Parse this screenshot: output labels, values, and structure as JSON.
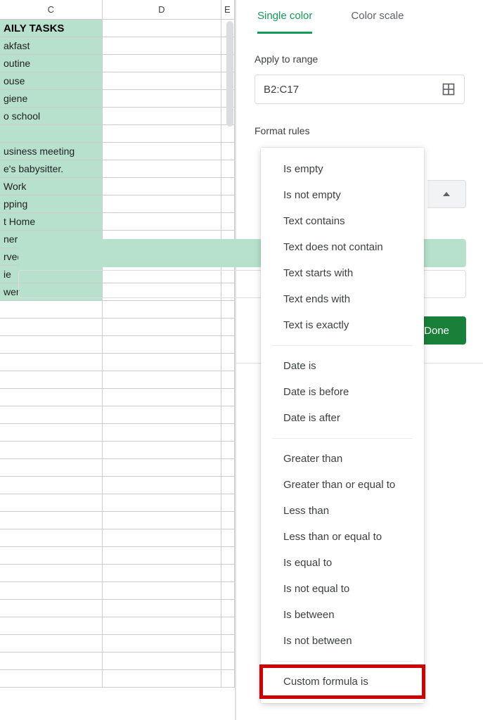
{
  "columns": {
    "c": "C",
    "d": "D",
    "e": "E"
  },
  "header_cell": "AILY TASKS",
  "task_rows": [
    "akfast",
    "outine",
    "ouse",
    "giene",
    "o school",
    "",
    "usiness meeting",
    "e's babysitter.",
    "Work",
    "pping",
    "t Home",
    "ner",
    "rved",
    "ie",
    "wer"
  ],
  "empty_row_count": 22,
  "sidebar": {
    "tabs": {
      "single_color": "Single color",
      "color_scale": "Color scale"
    },
    "apply_to_range_label": "Apply to range",
    "range_value": "B2:C17",
    "format_rules_label": "Format rules",
    "done_label": "Done"
  },
  "dropdown": {
    "group1": [
      "Is empty",
      "Is not empty",
      "Text contains",
      "Text does not contain",
      "Text starts with",
      "Text ends with",
      "Text is exactly"
    ],
    "group2": [
      "Date is",
      "Date is before",
      "Date is after"
    ],
    "group3": [
      "Greater than",
      "Greater than or equal to",
      "Less than",
      "Less than or equal to",
      "Is equal to",
      "Is not equal to",
      "Is between",
      "Is not between"
    ],
    "group4": [
      "Custom formula is"
    ]
  }
}
